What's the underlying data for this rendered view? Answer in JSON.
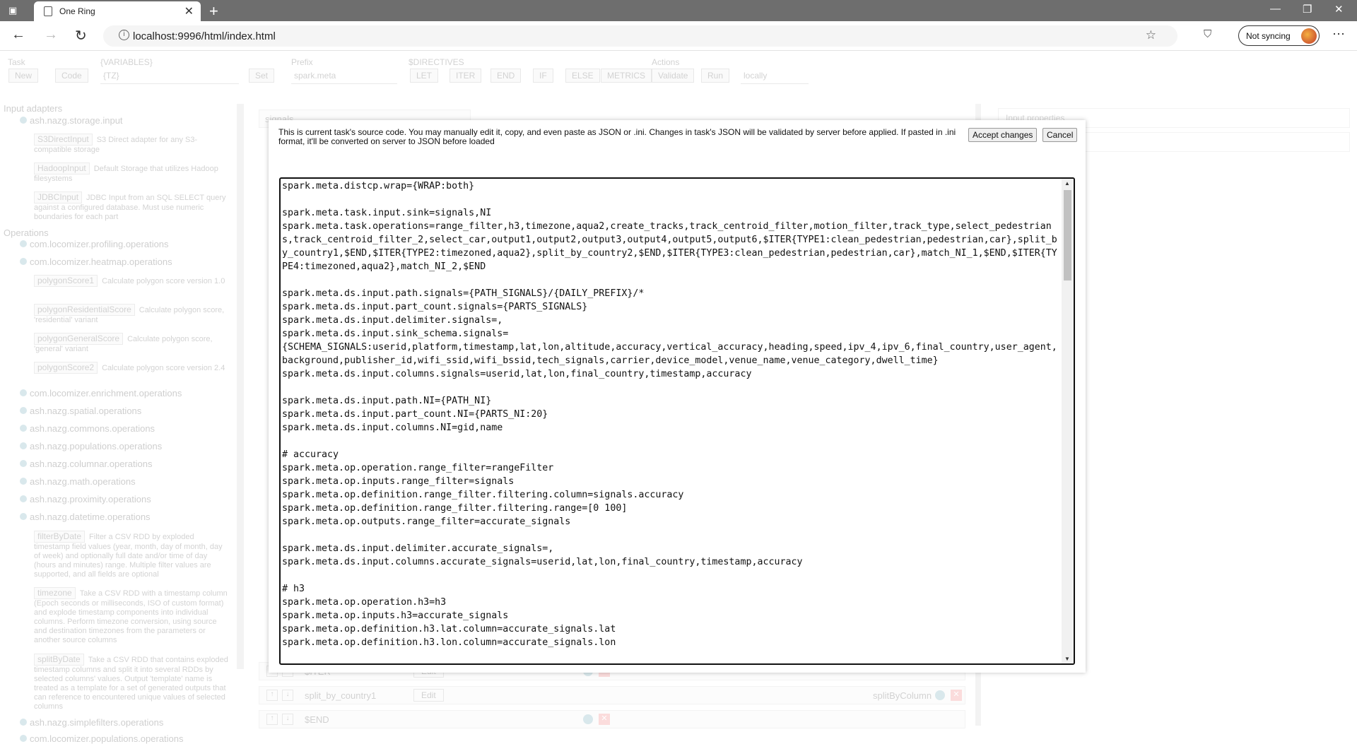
{
  "browser": {
    "tab_title": "One Ring",
    "url": "localhost:9996/html/index.html",
    "sync_label": "Not syncing"
  },
  "toolbar": {
    "task_label": "Task",
    "new_btn": "New",
    "code_btn": "Code",
    "variables_label": "{VARIABLES}",
    "variables_value": "{TZ}",
    "set_btn": "Set",
    "prefix_label": "Prefix",
    "prefix_value": "spark.meta",
    "directives_label": "$DIRECTIVES",
    "directives": [
      "LET",
      "ITER",
      "END",
      "IF",
      "ELSE",
      "METRICS"
    ],
    "actions_label": "Actions",
    "validate_btn": "Validate",
    "run_btn": "Run",
    "run_mode": "locally"
  },
  "sidebar": {
    "input_adapters_heading": "Input adapters",
    "storage_input": "ash.nazg.storage.input",
    "adapters": [
      {
        "name": "S3DirectInput",
        "desc": "S3 Direct adapter for any S3-compatible storage"
      },
      {
        "name": "HadoopInput",
        "desc": "Default Storage that utilizes Hadoop filesystems"
      },
      {
        "name": "JDBCInput",
        "desc": "JDBC Input from an SQL SELECT query against a configured database. Must use numeric boundaries for each part"
      }
    ],
    "operations_heading": "Operations",
    "pkg_profiling": "com.locomizer.profiling.operations",
    "pkg_heatmap": "com.locomizer.heatmap.operations",
    "heatmap_ops": [
      {
        "name": "polygonScore1",
        "desc": "Calculate polygon score version 1.0"
      },
      {
        "name": "polygonResidentialScore",
        "desc": "Calculate polygon score, 'residential' variant"
      },
      {
        "name": "polygonGeneralScore",
        "desc": "Calculate polygon score, 'general' variant"
      },
      {
        "name": "polygonScore2",
        "desc": "Calculate polygon score version 2.4"
      }
    ],
    "pkgs_mid": [
      "com.locomizer.enrichment.operations",
      "ash.nazg.spatial.operations",
      "ash.nazg.commons.operations",
      "ash.nazg.populations.operations",
      "ash.nazg.columnar.operations",
      "ash.nazg.math.operations",
      "ash.nazg.proximity.operations",
      "ash.nazg.datetime.operations"
    ],
    "datetime_ops": [
      {
        "name": "filterByDate",
        "desc": "Filter a CSV RDD by exploded timestamp field values (year, month, day of month, day of week) and optionally full date and/or time of day (hours and minutes) range. Multiple filter values are supported, and all fields are optional"
      },
      {
        "name": "timezone",
        "desc": "Take a CSV RDD with a timestamp column (Epoch seconds or milliseconds, ISO of custom format) and explode timestamp components into individual columns. Perform timezone conversion, using source and destination timezones from the parameters or another source columns"
      },
      {
        "name": "splitByDate",
        "desc": "Take a CSV RDD that contains exploded timestamp columns and split it into several RDDs by selected columns' values. Output 'template' name is treated as a template for a set of generated outputs that can reference to encountered unique values of selected columns"
      }
    ],
    "pkg_simplefilters": "ash.nazg.simplefilters.operations",
    "pkg_populations": "com.locomizer.populations.operations"
  },
  "workspace": {
    "signals_tab": "signals",
    "row_iter": "$ITER",
    "row_split_name": "split_by_country1",
    "row_split_op": "splitByColumn",
    "row_end": "$END",
    "edit_btn": "Edit",
    "right_panel_1": "Input properties",
    "right_panel_2": "Input properties"
  },
  "modal": {
    "message": "This is current task's source code. You may manually edit it, copy, and even paste as JSON or .ini. Changes in task's JSON will be validated by server before applied. If pasted in .ini format, it'll be converted on server to JSON before loaded",
    "accept_btn": "Accept changes",
    "cancel_btn": "Cancel",
    "code": "spark.meta.distcp.wrap={WRAP:both}\n\nspark.meta.task.input.sink=signals,NI\nspark.meta.task.operations=range_filter,h3,timezone,aqua2,create_tracks,track_centroid_filter,motion_filter,track_type,select_pedestrians,track_centroid_filter_2,select_car,output1,output2,output3,output4,output5,output6,$ITER{TYPE1:clean_pedestrian,pedestrian,car},split_by_country1,$END,$ITER{TYPE2:timezoned,aqua2},split_by_country2,$END,$ITER{TYPE3:clean_pedestrian,pedestrian,car},match_NI_1,$END,$ITER{TYPE4:timezoned,aqua2},match_NI_2,$END\n\nspark.meta.ds.input.path.signals={PATH_SIGNALS}/{DAILY_PREFIX}/*\nspark.meta.ds.input.part_count.signals={PARTS_SIGNALS}\nspark.meta.ds.input.delimiter.signals=,\nspark.meta.ds.input.sink_schema.signals=\n{SCHEMA_SIGNALS:userid,platform,timestamp,lat,lon,altitude,accuracy,vertical_accuracy,heading,speed,ipv_4,ipv_6,final_country,user_agent,background,publisher_id,wifi_ssid,wifi_bssid,tech_signals,carrier,device_model,venue_name,venue_category,dwell_time}\nspark.meta.ds.input.columns.signals=userid,lat,lon,final_country,timestamp,accuracy\n\nspark.meta.ds.input.path.NI={PATH_NI}\nspark.meta.ds.input.part_count.NI={PARTS_NI:20}\nspark.meta.ds.input.columns.NI=gid,name\n\n# accuracy\nspark.meta.op.operation.range_filter=rangeFilter\nspark.meta.op.inputs.range_filter=signals\nspark.meta.op.definition.range_filter.filtering.column=signals.accuracy\nspark.meta.op.definition.range_filter.filtering.range=[0 100]\nspark.meta.op.outputs.range_filter=accurate_signals\n\nspark.meta.ds.input.delimiter.accurate_signals=,\nspark.meta.ds.input.columns.accurate_signals=userid,lat,lon,final_country,timestamp,accuracy\n\n# h3\nspark.meta.op.operation.h3=h3\nspark.meta.op.inputs.h3=accurate_signals\nspark.meta.op.definition.h3.lat.column=accurate_signals.lat\nspark.meta.op.definition.h3.lon.column=accurate_signals.lon"
  }
}
